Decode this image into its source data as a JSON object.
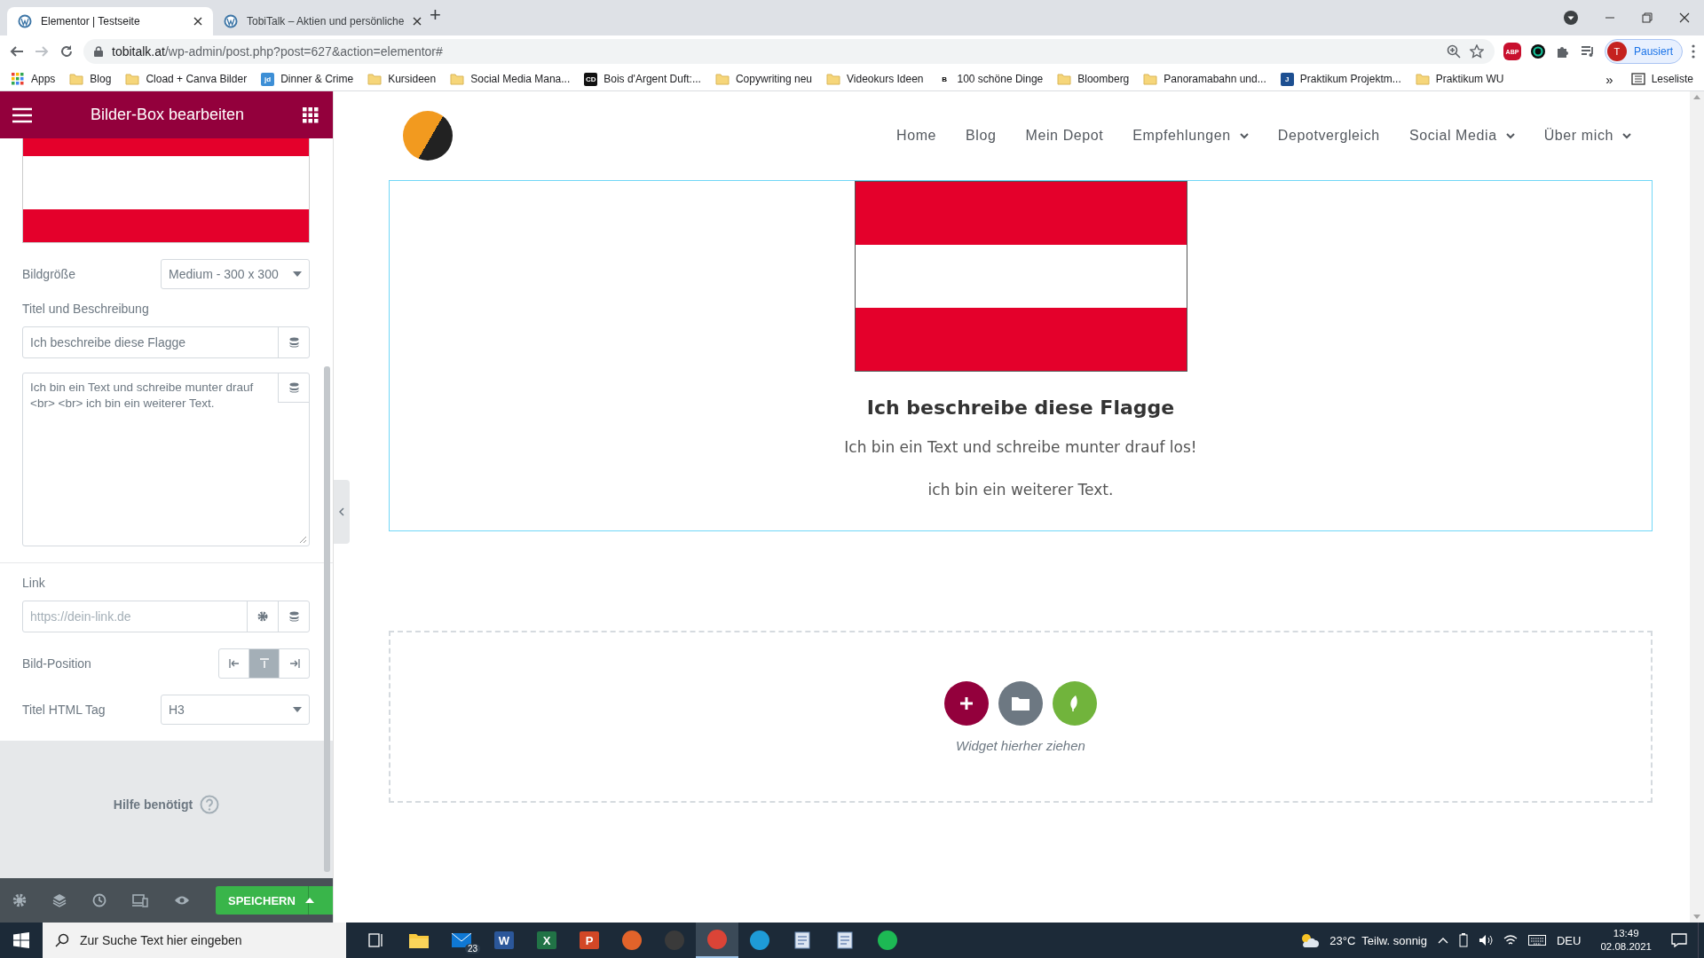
{
  "browser": {
    "tabs": [
      {
        "title": "Elementor | Testseite",
        "selected": true
      },
      {
        "title": "TobiTalk – Aktien und persönliche",
        "selected": false
      }
    ],
    "new_tab": "+",
    "url_host": "tobitalk.at",
    "url_path": "/wp-admin/post.php?post=627&action=elementor#",
    "extensions": [
      {
        "kind": "badge",
        "text": "ABP",
        "color": "#c8102e"
      },
      {
        "kind": "ring"
      },
      {
        "kind": "puzzle"
      },
      {
        "kind": "media"
      }
    ],
    "profile": {
      "initial": "T",
      "label": "Pausiert"
    },
    "bookmarks": [
      {
        "kind": "apps",
        "label": "Apps"
      },
      {
        "kind": "folder",
        "label": "Blog"
      },
      {
        "kind": "folder",
        "label": "Cload + Canva Bilder"
      },
      {
        "kind": "site",
        "badge": "jd",
        "color": "#3d8fd6",
        "label": "Dinner & Crime"
      },
      {
        "kind": "folder",
        "label": "Kursideen"
      },
      {
        "kind": "folder",
        "label": "Social Media Mana..."
      },
      {
        "kind": "site",
        "badge": "CD",
        "color": "#111111",
        "label": "Bois d'Argent Duft:..."
      },
      {
        "kind": "folder",
        "label": "Copywriting neu"
      },
      {
        "kind": "folder",
        "label": "Videokurs Ideen"
      },
      {
        "kind": "site",
        "badge": "B",
        "color": "#ffffff",
        "label": "100 schöne Dinge"
      },
      {
        "kind": "folder",
        "label": "Bloomberg"
      },
      {
        "kind": "folder",
        "label": "Panoramabahn und..."
      },
      {
        "kind": "site",
        "badge": "J",
        "color": "#1d4f91",
        "label": "Praktikum Projektm..."
      },
      {
        "kind": "folder",
        "label": "Praktikum WU"
      }
    ],
    "more": "»",
    "reading_list": "Leseliste"
  },
  "panel": {
    "title": "Bilder-Box bearbeiten",
    "controls": [
      {
        "kind": "select",
        "label": "Bildgröße",
        "value": "Medium - 300 x 300"
      },
      {
        "kind": "text",
        "label": "Titel und Beschreibung",
        "value": "Ich beschreibe diese Flagge"
      },
      {
        "kind": "textarea",
        "value": "Ich bin ein Text und schreibe munter drauf <br> <br> ich bin ein weiterer Text."
      },
      {
        "kind": "url",
        "label": "Link",
        "placeholder": "https://dein-link.de"
      },
      {
        "kind": "choose",
        "label": "Bild-Position",
        "options": [
          {
            "selected": false
          },
          {
            "selected": true
          },
          {
            "selected": false
          }
        ]
      },
      {
        "kind": "select",
        "label": "Titel HTML Tag",
        "value": "H3"
      }
    ],
    "help": "Hilfe benötigt",
    "save": "SPEICHERN"
  },
  "preview": {
    "nav": [
      {
        "label": "Home",
        "dropdown": false
      },
      {
        "label": "Blog",
        "dropdown": false
      },
      {
        "label": "Mein Depot",
        "dropdown": false
      },
      {
        "label": "Empfehlungen",
        "dropdown": true
      },
      {
        "label": "Depotvergleich",
        "dropdown": false
      },
      {
        "label": "Social Media",
        "dropdown": true
      },
      {
        "label": "Über mich",
        "dropdown": true
      }
    ],
    "heading": "Ich beschreibe diese Flagge",
    "paragraphs": [
      "Ich bin ein Text und schreibe munter drauf los!",
      "ich bin ein weiterer Text."
    ],
    "drop_hint": "Widget hierher ziehen"
  },
  "taskbar": {
    "search_placeholder": "Zur Suche Text hier eingeben",
    "apps": [
      {
        "kind": "taskview",
        "active": false
      },
      {
        "kind": "folder",
        "active": false
      },
      {
        "kind": "mail",
        "badge": "23",
        "active": false
      },
      {
        "kind": "letter",
        "letter": "W",
        "color": "#2b579a",
        "active": false
      },
      {
        "kind": "letter",
        "letter": "X",
        "color": "#217346",
        "active": false
      },
      {
        "kind": "letter",
        "letter": "P",
        "color": "#d24726",
        "active": false
      },
      {
        "kind": "disc",
        "color": "#e2632a",
        "active": false
      },
      {
        "kind": "disc",
        "color": "#3a3a3a",
        "active": false
      },
      {
        "kind": "disc",
        "color": "#db4437",
        "active": true
      },
      {
        "kind": "disc",
        "color": "#1e9bd7",
        "active": false
      },
      {
        "kind": "doc",
        "active": false
      },
      {
        "kind": "doc",
        "active": false
      },
      {
        "kind": "disc",
        "color": "#1db954",
        "active": false
      }
    ],
    "temperature": "23°C",
    "weather": "Teilw. sonnig",
    "language": "DEU",
    "time": "13:49",
    "date": "02.08.2021"
  }
}
